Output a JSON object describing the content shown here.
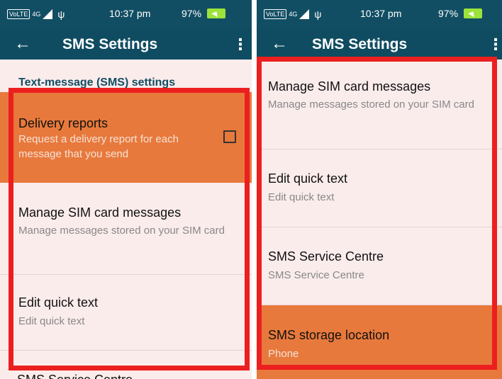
{
  "status": {
    "network": "VoLTE",
    "data_type": "4G",
    "time": "10:37 pm",
    "battery": "97%"
  },
  "app": {
    "title": "SMS Settings"
  },
  "left": {
    "section_header": "Text-message (SMS) settings",
    "rows": [
      {
        "title": "Delivery reports",
        "subtitle": "Request a delivery report for each message that you send",
        "checked": false
      },
      {
        "title": "Manage SIM card messages",
        "subtitle": "Manage messages stored on your SIM card"
      },
      {
        "title": "Edit quick text",
        "subtitle": "Edit quick text"
      }
    ],
    "cut_row_title": "SMS Service Centre"
  },
  "right": {
    "rows": [
      {
        "title": "Manage SIM card messages",
        "subtitle": "Manage messages stored on your SIM card"
      },
      {
        "title": "Edit quick text",
        "subtitle": "Edit quick text"
      },
      {
        "title": "SMS Service Centre",
        "subtitle": "SMS Service Centre"
      },
      {
        "title": "SMS storage location",
        "subtitle": "Phone"
      }
    ]
  },
  "colors": {
    "bar": "#124e63",
    "highlight": "#e8793c",
    "list_bg": "#fbecec",
    "annotation": "#ec1f1f"
  }
}
